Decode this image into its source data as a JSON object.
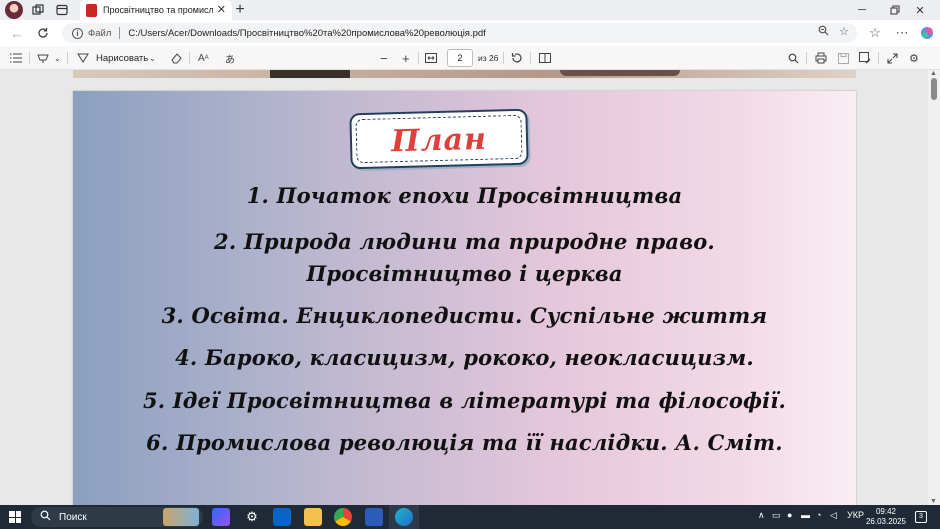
{
  "browser": {
    "tab_title": "Просвітництво та промислова р",
    "tab_close": "✕",
    "new_tab": "+",
    "address": {
      "file_label": "Файл",
      "url": "C:/Users/Acer/Downloads/Просвітництво%20та%20промислова%20революція.pdf"
    }
  },
  "pdf_toolbar": {
    "draw_label": "Нарисовать",
    "zoom_out": "−",
    "zoom_in": "+",
    "current_page": "2",
    "page_of": "из 26"
  },
  "slide": {
    "title": "План",
    "items": [
      "1. Початок епохи Просвітництва",
      "2. Природа людини та природне право.",
      "Просвітництво і церква",
      "3. Освіта. Енциклопедисти. Суспільне життя",
      "4. Бароко, класицизм, рококо, неокласицизм.",
      "5. Ідеї Просвітництва в літературі та філософії.",
      "6. Промислова революція та її наслідки. А. Сміт."
    ]
  },
  "taskbar": {
    "search_label": "Поиск",
    "language": "УКР",
    "time": "09:42",
    "date": "26.03.2025",
    "notification_count": "3"
  },
  "colors": {
    "plan_title": "#e0403c",
    "frame_border": "#243f5c",
    "taskbar_bg": "#1f2a36"
  }
}
